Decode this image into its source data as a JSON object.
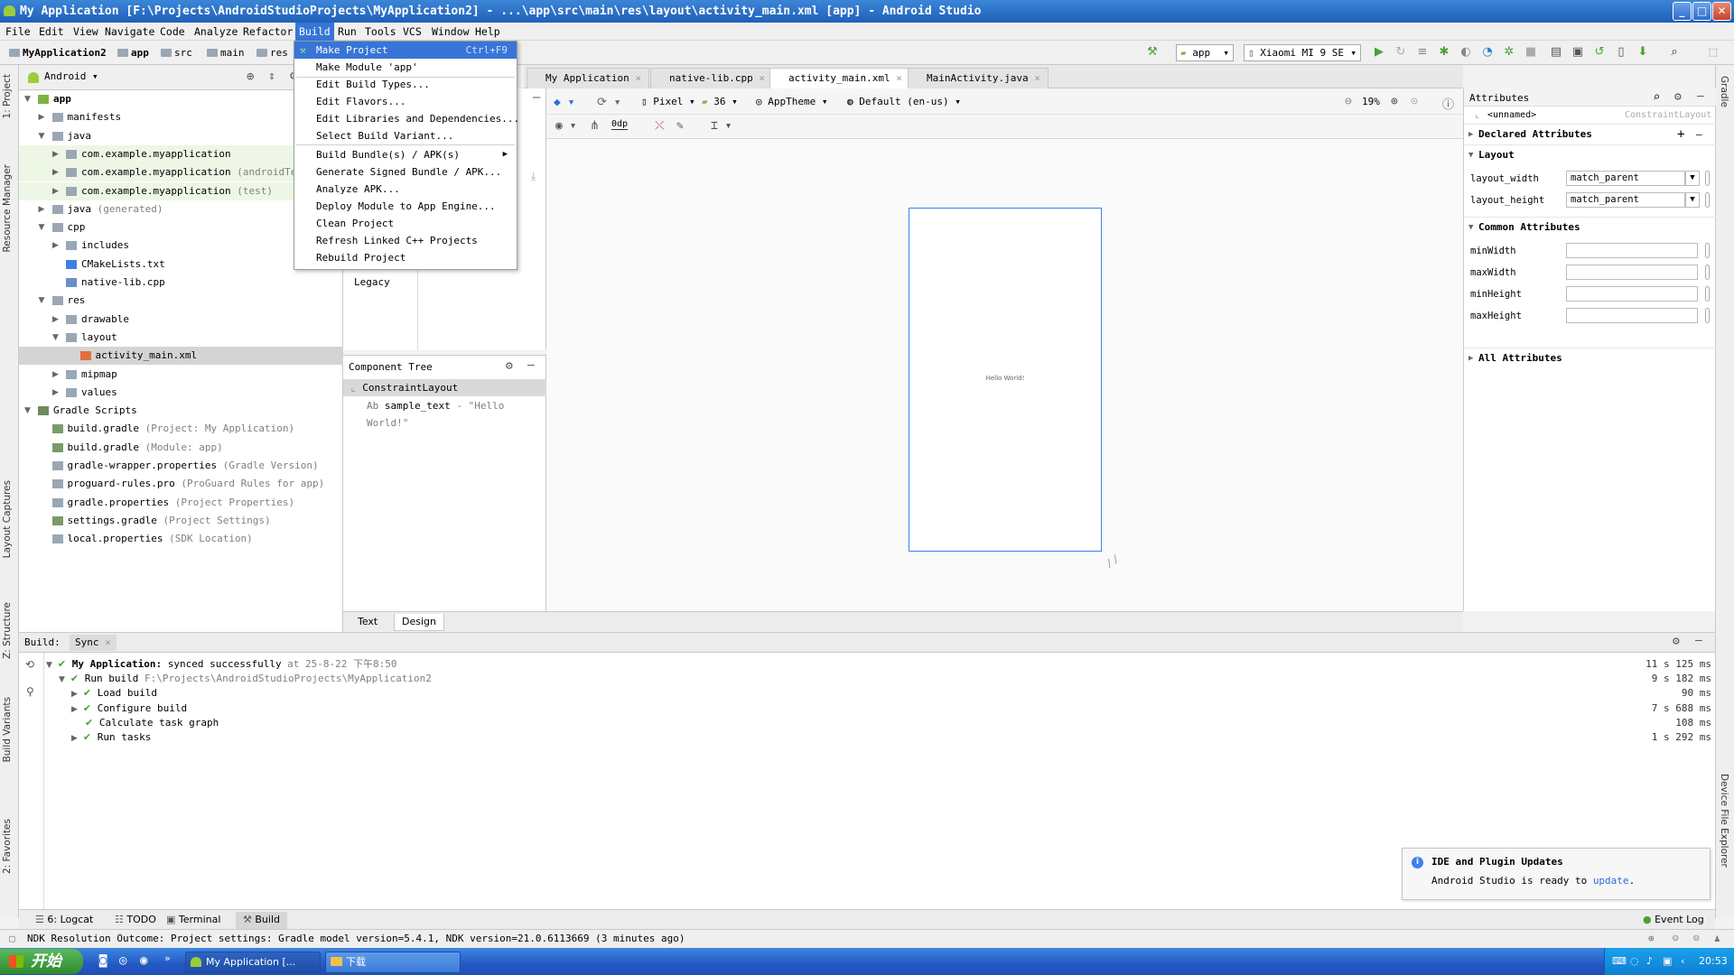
{
  "window": {
    "title": "My Application [F:\\Projects\\AndroidStudioProjects\\MyApplication2] - ...\\app\\src\\main\\res\\layout\\activity_main.xml [app] - Android Studio",
    "minimize": "_",
    "maximize": "□",
    "close": "✕"
  },
  "menubar": [
    "File",
    "Edit",
    "View",
    "Navigate",
    "Code",
    "Analyze",
    "Refactor",
    "Build",
    "Run",
    "Tools",
    "VCS",
    "Window",
    "Help"
  ],
  "breadcrumbs": [
    "MyApplication2",
    "app",
    "src",
    "main",
    "res"
  ],
  "toolbar": {
    "run_config": "app",
    "device": "Xiaomi MI 9 SE"
  },
  "build_menu": {
    "items": [
      {
        "label": "Make Project",
        "shortcut": "Ctrl+F9"
      },
      {
        "label": "Make Module 'app'"
      },
      {
        "label": "Edit Build Types..."
      },
      {
        "label": "Edit Flavors..."
      },
      {
        "label": "Edit Libraries and Dependencies..."
      },
      {
        "label": "Select Build Variant..."
      },
      {
        "label": "Build Bundle(s) / APK(s)"
      },
      {
        "label": "Generate Signed Bundle / APK..."
      },
      {
        "label": "Analyze APK..."
      },
      {
        "label": "Deploy Module to App Engine..."
      },
      {
        "label": "Clean Project"
      },
      {
        "label": "Refresh Linked C++ Projects"
      },
      {
        "label": "Rebuild Project"
      }
    ]
  },
  "project": {
    "view": "Android",
    "tree": [
      {
        "label": "app",
        "bold": true
      },
      {
        "label": "manifests"
      },
      {
        "label": "java"
      },
      {
        "label": "com.example.myapplication"
      },
      {
        "label": "com.example.myapplication",
        "note": "(androidTest)"
      },
      {
        "label": "com.example.myapplication",
        "note": "(test)"
      },
      {
        "label": "java",
        "note": "(generated)"
      },
      {
        "label": "cpp"
      },
      {
        "label": "includes"
      },
      {
        "label": "CMakeLists.txt"
      },
      {
        "label": "native-lib.cpp"
      },
      {
        "label": "res"
      },
      {
        "label": "drawable"
      },
      {
        "label": "layout"
      },
      {
        "label": "activity_main.xml"
      },
      {
        "label": "mipmap"
      },
      {
        "label": "values"
      },
      {
        "label": "Gradle Scripts"
      },
      {
        "label": "build.gradle",
        "note": "(Project: My Application)"
      },
      {
        "label": "build.gradle",
        "note": "(Module: app)"
      },
      {
        "label": "gradle-wrapper.properties",
        "note": "(Gradle Version)"
      },
      {
        "label": "proguard-rules.pro",
        "note": "(ProGuard Rules for app)"
      },
      {
        "label": "gradle.properties",
        "note": "(Project Properties)"
      },
      {
        "label": "settings.gradle",
        "note": "(Project Settings)"
      },
      {
        "label": "local.properties",
        "note": "(SDK Location)"
      }
    ]
  },
  "editor_tabs": [
    "My Application",
    "native-lib.cpp",
    "activity_main.xml",
    "MainActivity.java"
  ],
  "design_toolbar": {
    "device": "Pixel",
    "api": "36",
    "theme": "AppTheme",
    "locale": "Default (en-us)",
    "zoom": "19%",
    "margin": "0dp"
  },
  "palette": {
    "legacy": "Legacy"
  },
  "component_tree": {
    "title": "Component Tree",
    "root": "ConstraintLayout",
    "child_prefix": "Ab",
    "child": "sample_text",
    "child_value": "- \"Hello World!\""
  },
  "preview": {
    "text": "Hello World!"
  },
  "editor_bottom_tabs": [
    "Text",
    "Design"
  ],
  "attributes": {
    "title": "Attributes",
    "id": "<unnamed>",
    "class": "ConstraintLayout",
    "sections": {
      "declared": "Declared Attributes",
      "layout": "Layout",
      "common": "Common Attributes",
      "all": "All Attributes"
    },
    "layout_width": {
      "name": "layout_width",
      "value": "match_parent"
    },
    "layout_height": {
      "name": "layout_height",
      "value": "match_parent"
    },
    "common": [
      "minWidth",
      "maxWidth",
      "minHeight",
      "maxHeight"
    ]
  },
  "build_panel": {
    "tabs": [
      "Build:",
      "Sync"
    ],
    "rows": [
      {
        "label": "My Application:",
        "rest": "synced successfully",
        "time_info": "at 25-8-22 下午8:50",
        "duration": "11 s 125 ms"
      },
      {
        "label": "Run build",
        "rest": "F:\\Projects\\AndroidStudioProjects\\MyApplication2",
        "duration": "9 s 182 ms"
      },
      {
        "label": "Load build",
        "duration": "90 ms"
      },
      {
        "label": "Configure build",
        "duration": "7 s 688 ms"
      },
      {
        "label": "Calculate task graph",
        "duration": "108 ms"
      },
      {
        "label": "Run tasks",
        "duration": "1 s 292 ms"
      }
    ]
  },
  "notification": {
    "title": "IDE and Plugin Updates",
    "body": "Android Studio is ready to",
    "link": "update",
    "tail": "."
  },
  "tool_windows": [
    "6: Logcat",
    "TODO",
    "Terminal",
    "Build"
  ],
  "event_log": "Event Log",
  "status": "NDK Resolution Outcome: Project settings: Gradle model version=5.4.1, NDK version=21.0.6113669 (3 minutes ago)",
  "side_tabs_left": [
    "1: Project",
    "Resource Manager",
    "Layout Captures",
    "Z: Structure",
    "Build Variants",
    "2: Favorites"
  ],
  "side_tabs_right": [
    "Gradle",
    "Device File Explorer"
  ],
  "taskbar": {
    "start": "开始",
    "apps": [
      "My Application [...",
      "下载"
    ],
    "clock": "20:53"
  }
}
